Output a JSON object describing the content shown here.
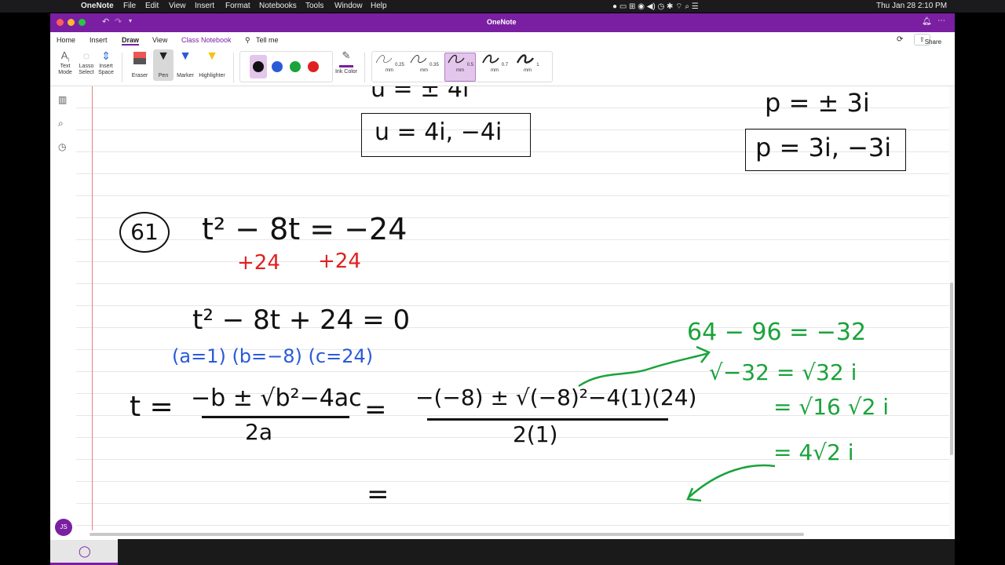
{
  "menubar": {
    "app": "OneNote",
    "items": [
      "File",
      "Edit",
      "View",
      "Insert",
      "Format",
      "Notebooks",
      "Tools",
      "Window",
      "Help"
    ],
    "clock": "Thu Jan 28  2:10 PM"
  },
  "window": {
    "title": "OneNote",
    "accent": "#7a1fa2"
  },
  "ribbon_tabs": [
    "Home",
    "Insert",
    "Draw",
    "View",
    "Class Notebook",
    "Tell me"
  ],
  "share_label": "Share",
  "tools": [
    {
      "name": "text-mode",
      "label": "Text Mode"
    },
    {
      "name": "lasso-select",
      "label": "Lasso Select"
    },
    {
      "name": "insert-space",
      "label": "Insert Space"
    },
    {
      "name": "eraser",
      "label": "Eraser"
    },
    {
      "name": "pen",
      "label": "Pen"
    },
    {
      "name": "marker",
      "label": "Marker"
    },
    {
      "name": "highlighter",
      "label": "Highlighter"
    }
  ],
  "colors": [
    "#111111",
    "#2a5bd7",
    "#1aa33a",
    "#e02020"
  ],
  "ink_color_label": "Ink Color",
  "widths": [
    "0.25 mm",
    "0.35 mm",
    "0.5 mm",
    "0.7 mm",
    "1 mm"
  ],
  "selected_width": "0.5 mm",
  "avatar_initials": "JS",
  "badge_count": "9",
  "notes": {
    "top_partial_left": "u = ± 4i",
    "box_left": "u = 4i, −4i",
    "top_partial_right": "p = ± 3i",
    "box_right": "p = 3i, −3i",
    "problem_number": "61",
    "eq1": "t² − 8t = −24",
    "plus_left": "+24",
    "plus_right": "+24",
    "eq2": "t² − 8t + 24 = 0",
    "coeffs": "(a=1)  (b=−8)  (c=24)",
    "t_eq": "t =",
    "qf_num": "−b ± √b²−4ac",
    "qf_den": "2a",
    "eq_sign": "=",
    "sub_num": "−(−8) ± √(−8)²−4(1)(24)",
    "sub_den": "2(1)",
    "eq_sign2": "=",
    "g1": "64 − 96 = −32",
    "g2": "√−32 = √32 i",
    "g3": "= √16 √2 i",
    "g4": "= 4√2 i"
  }
}
